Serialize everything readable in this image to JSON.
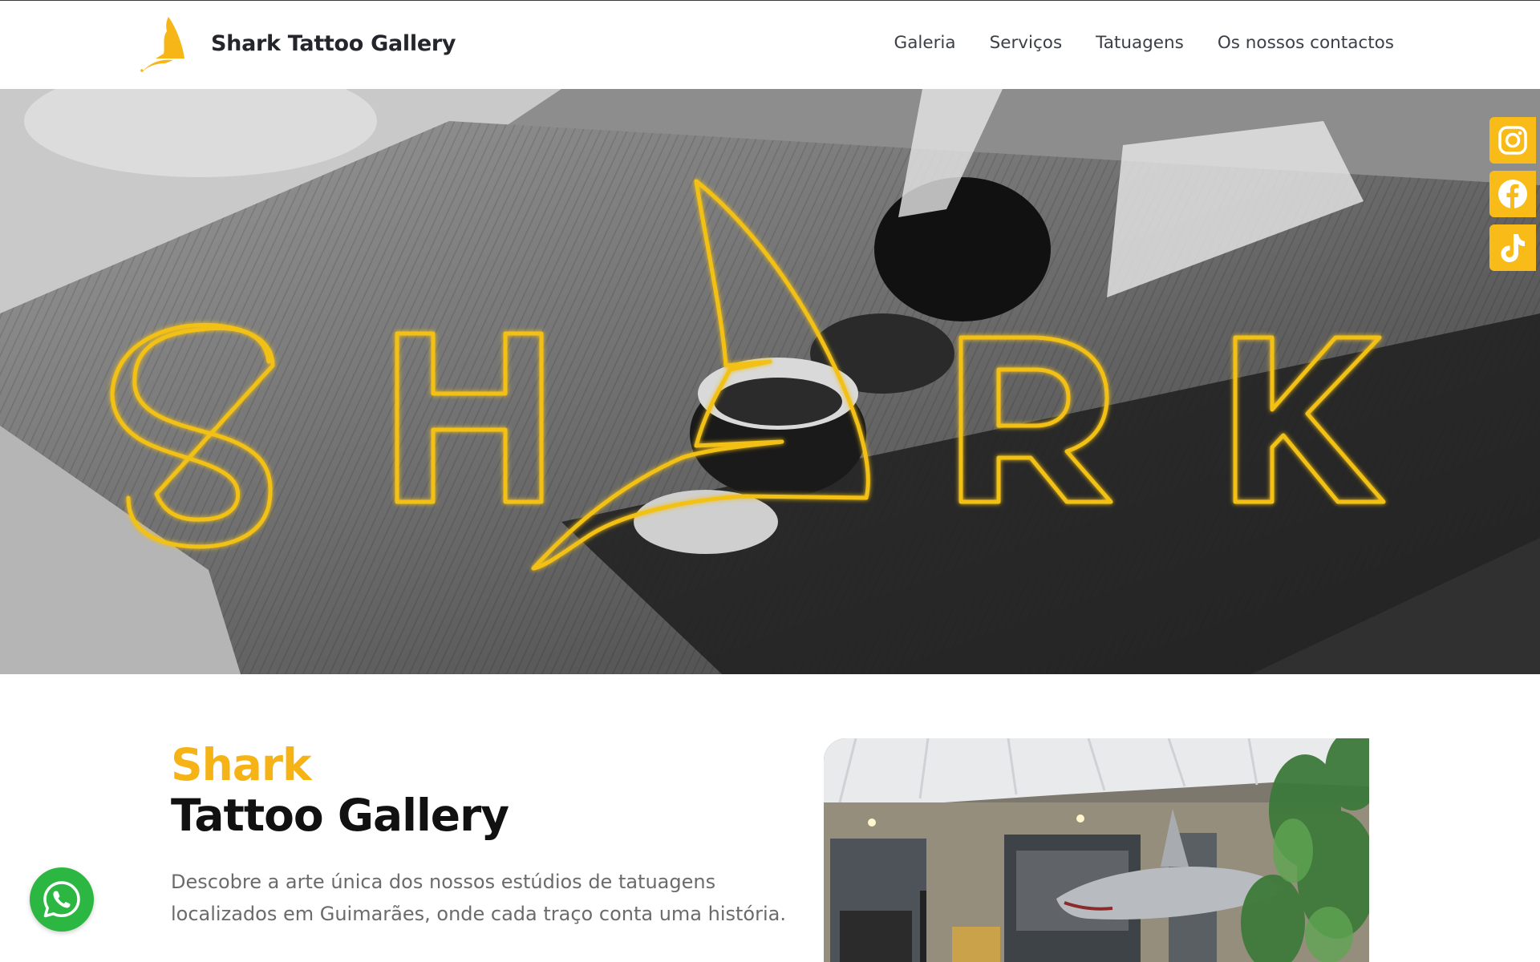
{
  "header": {
    "site_title": "Shark Tattoo Gallery",
    "nav": [
      "Galeria",
      "Serviços",
      "Tatuagens",
      "Os nossos contactos"
    ]
  },
  "hero": {
    "logo_letters": [
      "S",
      "H",
      "R",
      "K"
    ]
  },
  "social": {
    "icons": [
      "instagram-icon",
      "facebook-icon",
      "tiktok-icon"
    ]
  },
  "intro": {
    "title_highlight": "Shark",
    "title_rest": "Tattoo Gallery",
    "description": "Descobre a arte única dos nossos estúdios de tatuagens localizados em Guimarães, onde cada traço conta uma história."
  },
  "colors": {
    "accent": "#f8bb18",
    "whatsapp": "#2bb741",
    "text_dark": "#111111",
    "text_muted": "#6b6b6b"
  }
}
